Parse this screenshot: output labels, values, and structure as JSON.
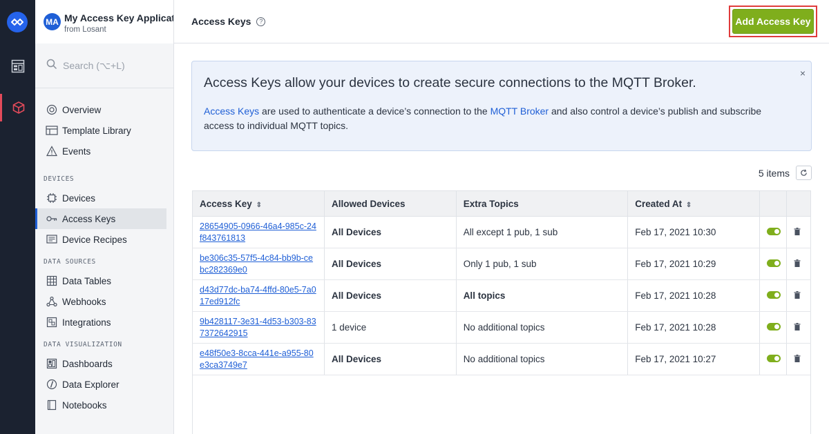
{
  "app": {
    "avatar_initials": "MA",
    "name": "My Access Key Applicat...",
    "org": "from Losant"
  },
  "search": {
    "placeholder": "Search (⌥+L)"
  },
  "sidebar": {
    "top_items": [
      {
        "label": "Overview",
        "icon": "overview-icon"
      },
      {
        "label": "Template Library",
        "icon": "template-library-icon"
      },
      {
        "label": "Events",
        "icon": "events-icon"
      }
    ],
    "sections": [
      {
        "label": "DEVICES",
        "items": [
          {
            "label": "Devices",
            "icon": "device-chip-icon"
          },
          {
            "label": "Access Keys",
            "icon": "access-key-icon",
            "active": true
          },
          {
            "label": "Device Recipes",
            "icon": "device-recipes-icon"
          }
        ]
      },
      {
        "label": "DATA SOURCES",
        "items": [
          {
            "label": "Data Tables",
            "icon": "data-tables-icon"
          },
          {
            "label": "Webhooks",
            "icon": "webhooks-icon"
          },
          {
            "label": "Integrations",
            "icon": "integrations-icon"
          }
        ]
      },
      {
        "label": "DATA VISUALIZATION",
        "items": [
          {
            "label": "Dashboards",
            "icon": "dashboards-icon"
          },
          {
            "label": "Data Explorer",
            "icon": "data-explorer-icon"
          },
          {
            "label": "Notebooks",
            "icon": "notebooks-icon"
          }
        ]
      }
    ]
  },
  "header": {
    "title": "Access Keys",
    "help_glyph": "?",
    "add_button": "Add Access Key"
  },
  "banner": {
    "title": "Access Keys allow your devices to create secure connections to the MQTT Broker.",
    "link1": "Access Keys",
    "text1": " are used to authenticate a device’s connection to the ",
    "link2": "MQTT Broker",
    "text2": " and also control a device’s publish and subscribe access to individual MQTT topics.",
    "close": "×"
  },
  "list": {
    "count": "5 items",
    "columns": [
      "Access Key",
      "Allowed Devices",
      "Extra Topics",
      "Created At"
    ],
    "rows": [
      {
        "key": "28654905-0966-46a4-985c-24f843761813",
        "devices": "All Devices",
        "devices_bold": true,
        "topics": "All except 1 pub, 1 sub",
        "topics_bold": false,
        "created": "Feb 17, 2021 10:30",
        "enabled": true
      },
      {
        "key": "be306c35-57f5-4c84-bb9b-cebc282369e0",
        "devices": "All Devices",
        "devices_bold": true,
        "topics": "Only 1 pub, 1 sub",
        "topics_bold": false,
        "created": "Feb 17, 2021 10:29",
        "enabled": true
      },
      {
        "key": "d43d77dc-ba74-4ffd-80e5-7a017ed912fc",
        "devices": "All Devices",
        "devices_bold": true,
        "topics": "All topics",
        "topics_bold": true,
        "created": "Feb 17, 2021 10:28",
        "enabled": true
      },
      {
        "key": "9b428117-3e31-4d53-b303-837372642915",
        "devices": "1 device",
        "devices_bold": false,
        "topics": "No additional topics",
        "topics_bold": false,
        "created": "Feb 17, 2021 10:28",
        "enabled": true
      },
      {
        "key": "e48f50e3-8cca-441e-a955-80e3ca3749e7",
        "devices": "All Devices",
        "devices_bold": true,
        "topics": "No additional topics",
        "topics_bold": false,
        "created": "Feb 17, 2021 10:27",
        "enabled": true
      }
    ]
  },
  "colors": {
    "accent": "#1f5fd6",
    "primary_button": "#7fae1c",
    "highlight_border": "#e03b3b",
    "rail": "#1b2230"
  }
}
